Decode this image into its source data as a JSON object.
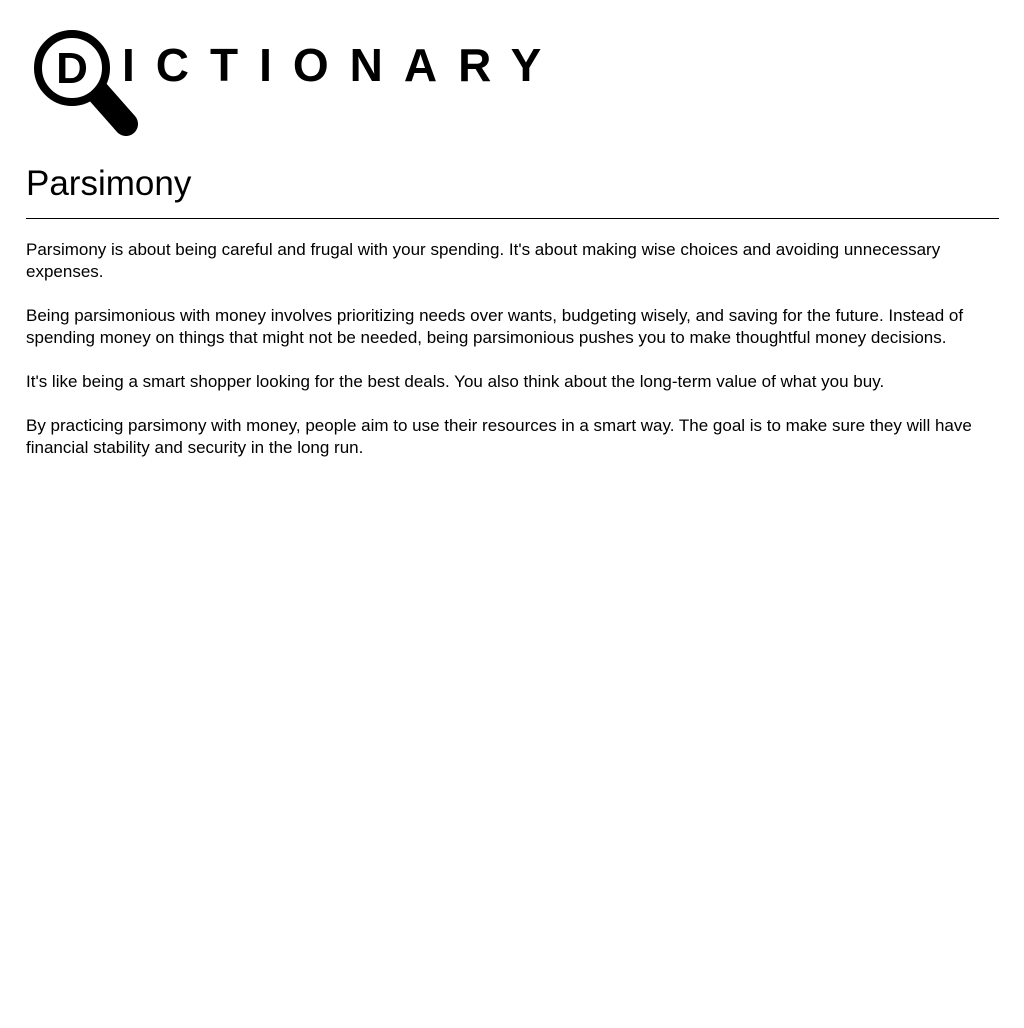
{
  "logo": {
    "first_letter": "D",
    "rest": "ICTIONARY"
  },
  "entry": {
    "word": "Parsimony",
    "paragraphs": [
      "Parsimony is about being careful and frugal with your spending. It's about making wise choices and avoiding unnecessary expenses.",
      "Being parsimonious with money involves prioritizing needs over wants, budgeting wisely, and saving for the future. Instead of spending money on things that might not be needed, being parsimonious pushes you to make thoughtful money decisions.",
      "It's like being a smart shopper looking for the best deals. You also think about the long-term value of what you buy.",
      "By practicing parsimony with money, people aim to use their resources in a smart way. The goal is to make sure they will have financial stability and security in the long run."
    ]
  }
}
